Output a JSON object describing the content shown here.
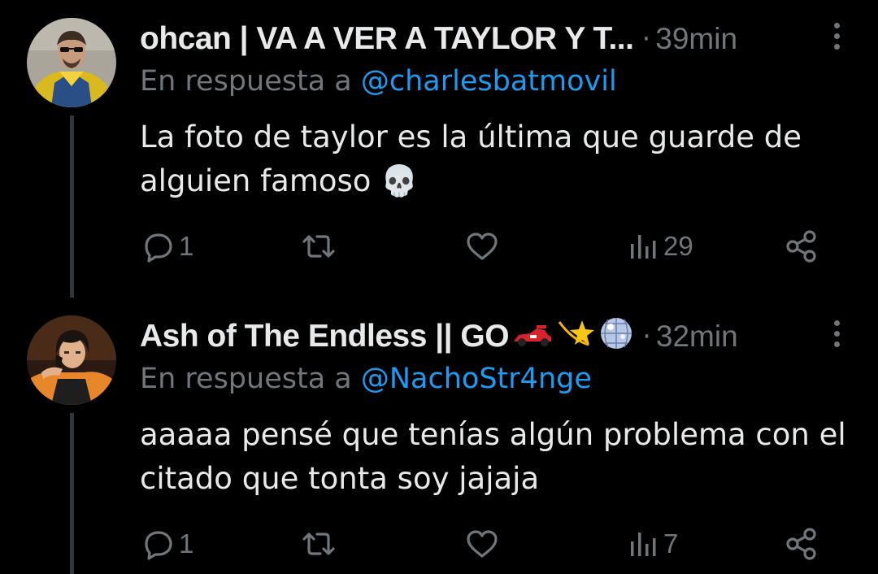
{
  "tweets": [
    {
      "display_name": "ohcan | VA A VER A TAYLOR Y T...",
      "separator": "·",
      "time": "39min",
      "reply_prefix": "En respuesta a",
      "reply_handle": "@charlesbatmovil",
      "text_lines": [
        "La foto de taylor es la última que guarde de",
        "alguien famoso 💀"
      ],
      "reply_count": "1",
      "retweet_count": "",
      "like_count": "",
      "views": "29",
      "name_emojis": []
    },
    {
      "display_name": "Ash of The Endless || GO",
      "separator": "·",
      "time": "32min",
      "reply_prefix": "En respuesta a",
      "reply_handle": "@NachoStr4nge",
      "text_lines": [
        "aaaaa pensé que tenías algún problema con el",
        "citado que tonta soy jajaja"
      ],
      "reply_count": "1",
      "retweet_count": "",
      "like_count": "",
      "views": "7",
      "name_emojis": [
        "🏎️",
        "💫",
        "🪩"
      ]
    }
  ],
  "colors": {
    "background": "#000000",
    "text": "#e7e9ea",
    "secondary": "#71767b",
    "link": "#1d9bf0",
    "thread_line": "#333639"
  },
  "icons": [
    "reply-icon",
    "retweet-icon",
    "like-icon",
    "views-icon",
    "share-icon",
    "more-icon",
    "skull-emoji"
  ]
}
